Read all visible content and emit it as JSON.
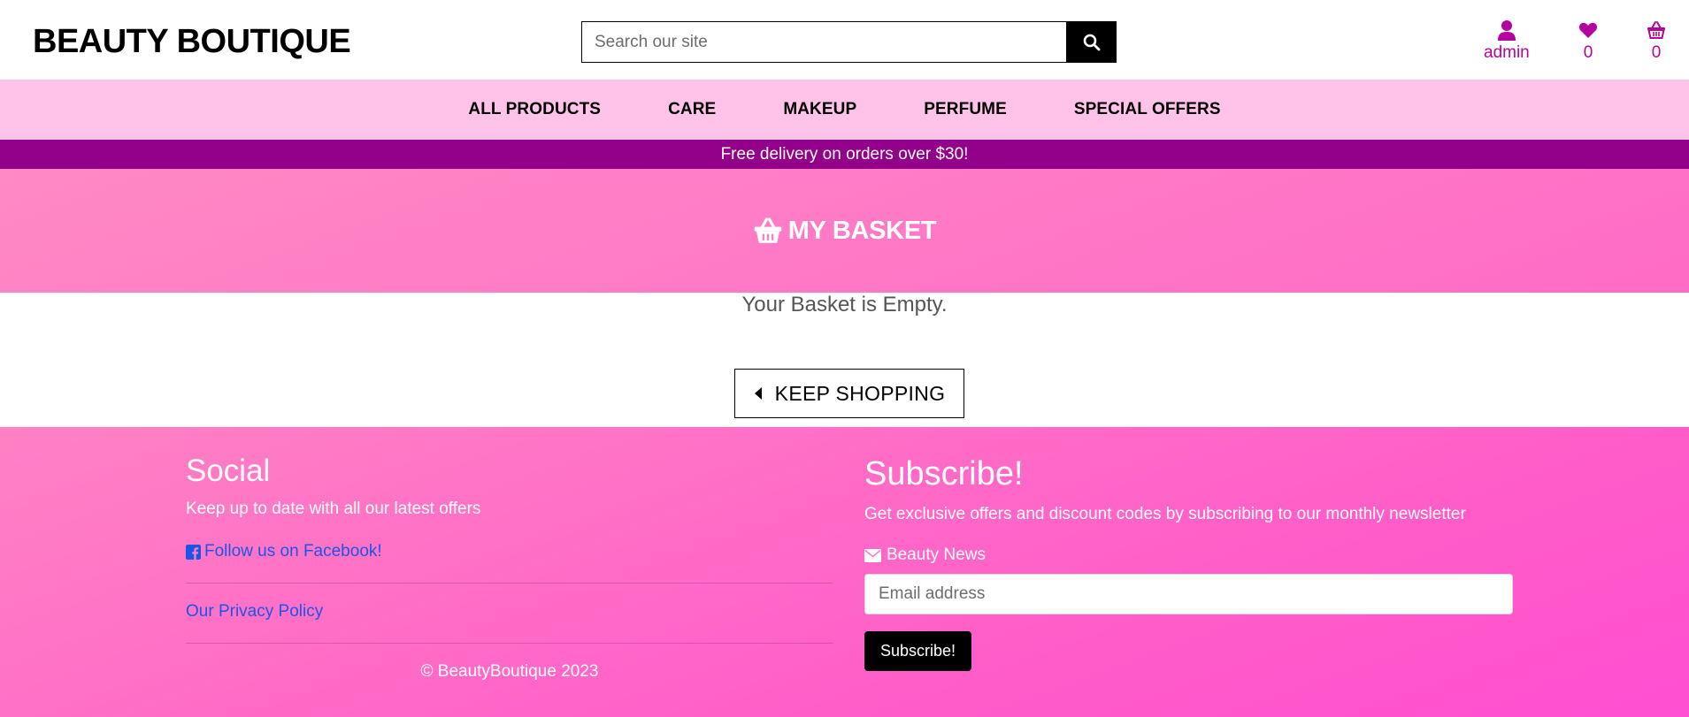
{
  "header": {
    "logo": "BEAUTY BOUTIQUE",
    "search_placeholder": "Search our site",
    "account_label": "admin",
    "wishlist_count": "0",
    "basket_count": "0"
  },
  "nav": {
    "items": [
      "ALL PRODUCTS",
      "CARE",
      "MAKEUP",
      "PERFUME",
      "SPECIAL OFFERS"
    ]
  },
  "banner": {
    "text": "Free delivery on orders over $30!"
  },
  "page": {
    "title": "MY BASKET",
    "empty_message": "Your Basket is Empty.",
    "keep_shopping_label": "KEEP SHOPPING"
  },
  "footer": {
    "social_title": "Social",
    "social_text": "Keep up to date with all our latest offers",
    "facebook_link": "Follow us on Facebook!",
    "privacy_link": "Our Privacy Policy",
    "copyright": "© BeautyBoutique 2023",
    "subscribe_title": "Subscribe!",
    "subscribe_text": "Get exclusive offers and discount codes by subscribing to our monthly newsletter",
    "newsletter_label": "Beauty News",
    "email_placeholder": "Email address",
    "subscribe_button": "Subscribe!"
  },
  "colors": {
    "accent": "#b5039f",
    "nav_bg": "#ffc3e9",
    "banner_bg": "#93008a",
    "hero_bg": "#ff7ac6",
    "link": "#1a56e6"
  },
  "icons": {
    "search": "search-icon",
    "account": "user-icon",
    "wishlist": "heart-icon",
    "basket": "basket-icon",
    "back": "caret-left-icon",
    "facebook": "facebook-icon",
    "mail": "envelope-icon"
  }
}
